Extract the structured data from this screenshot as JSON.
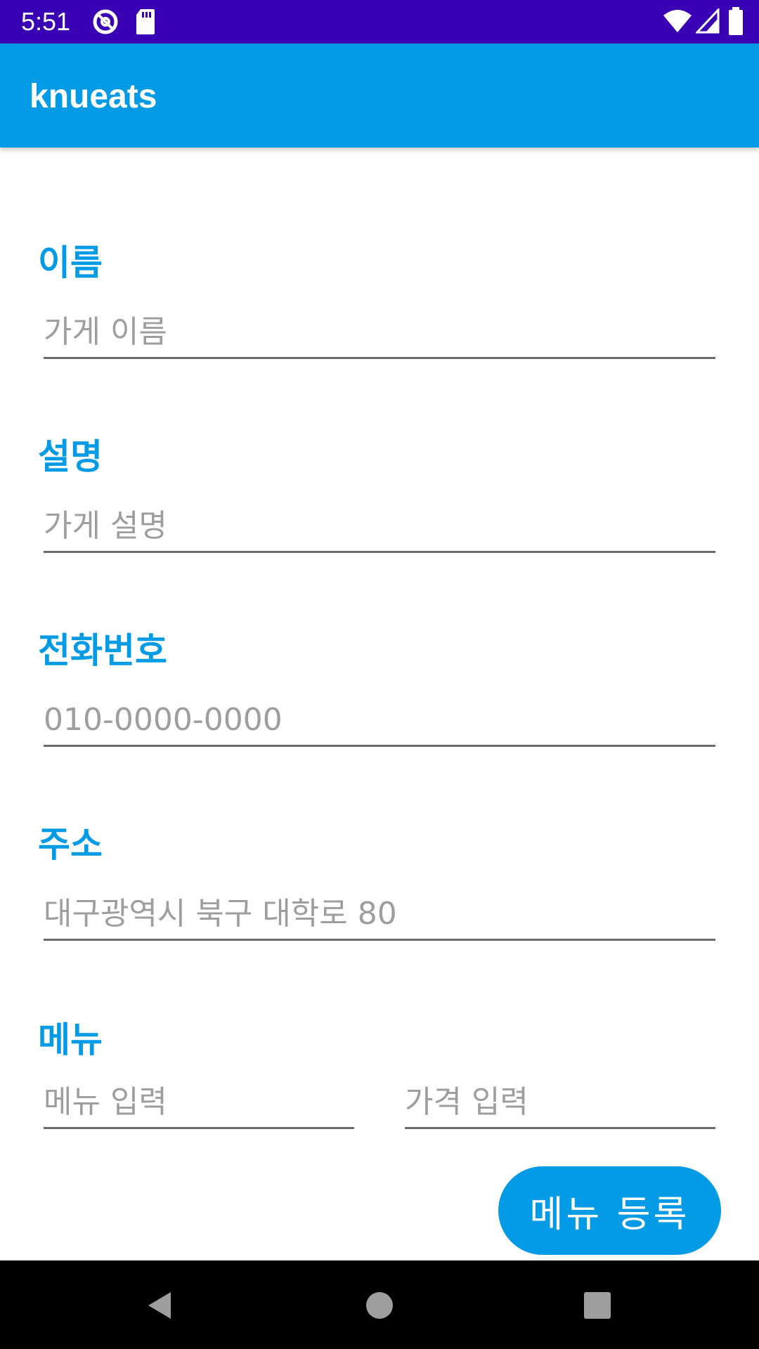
{
  "status_bar": {
    "time": "5:51",
    "icons": [
      "at-sign-icon",
      "sd-card-icon",
      "wifi-icon",
      "cell-signal-icon",
      "battery-icon"
    ],
    "background": "#3a00b3"
  },
  "app_bar": {
    "title": "knueats",
    "background": "#039be5"
  },
  "form": {
    "name": {
      "label": "이름",
      "placeholder": "가게 이름",
      "value": ""
    },
    "description": {
      "label": "설명",
      "placeholder": "가게 설명",
      "value": ""
    },
    "phone": {
      "label": "전화번호",
      "placeholder": "010-0000-0000",
      "value": ""
    },
    "address": {
      "label": "주소",
      "placeholder": "대구광역시 북구 대학로 80",
      "value": ""
    },
    "menu": {
      "label": "메뉴",
      "item_placeholder": "메뉴 입력",
      "price_placeholder": "가격 입력",
      "item_value": "",
      "price_value": ""
    },
    "register_menu_label": "메뉴 등록"
  },
  "nav_bar": {
    "buttons": [
      "back-icon",
      "home-icon",
      "recents-icon"
    ]
  },
  "colors": {
    "accent": "#039be5",
    "status_bar": "#3a00b3",
    "placeholder": "#9e9e9e",
    "underline": "#6b6b6b"
  }
}
